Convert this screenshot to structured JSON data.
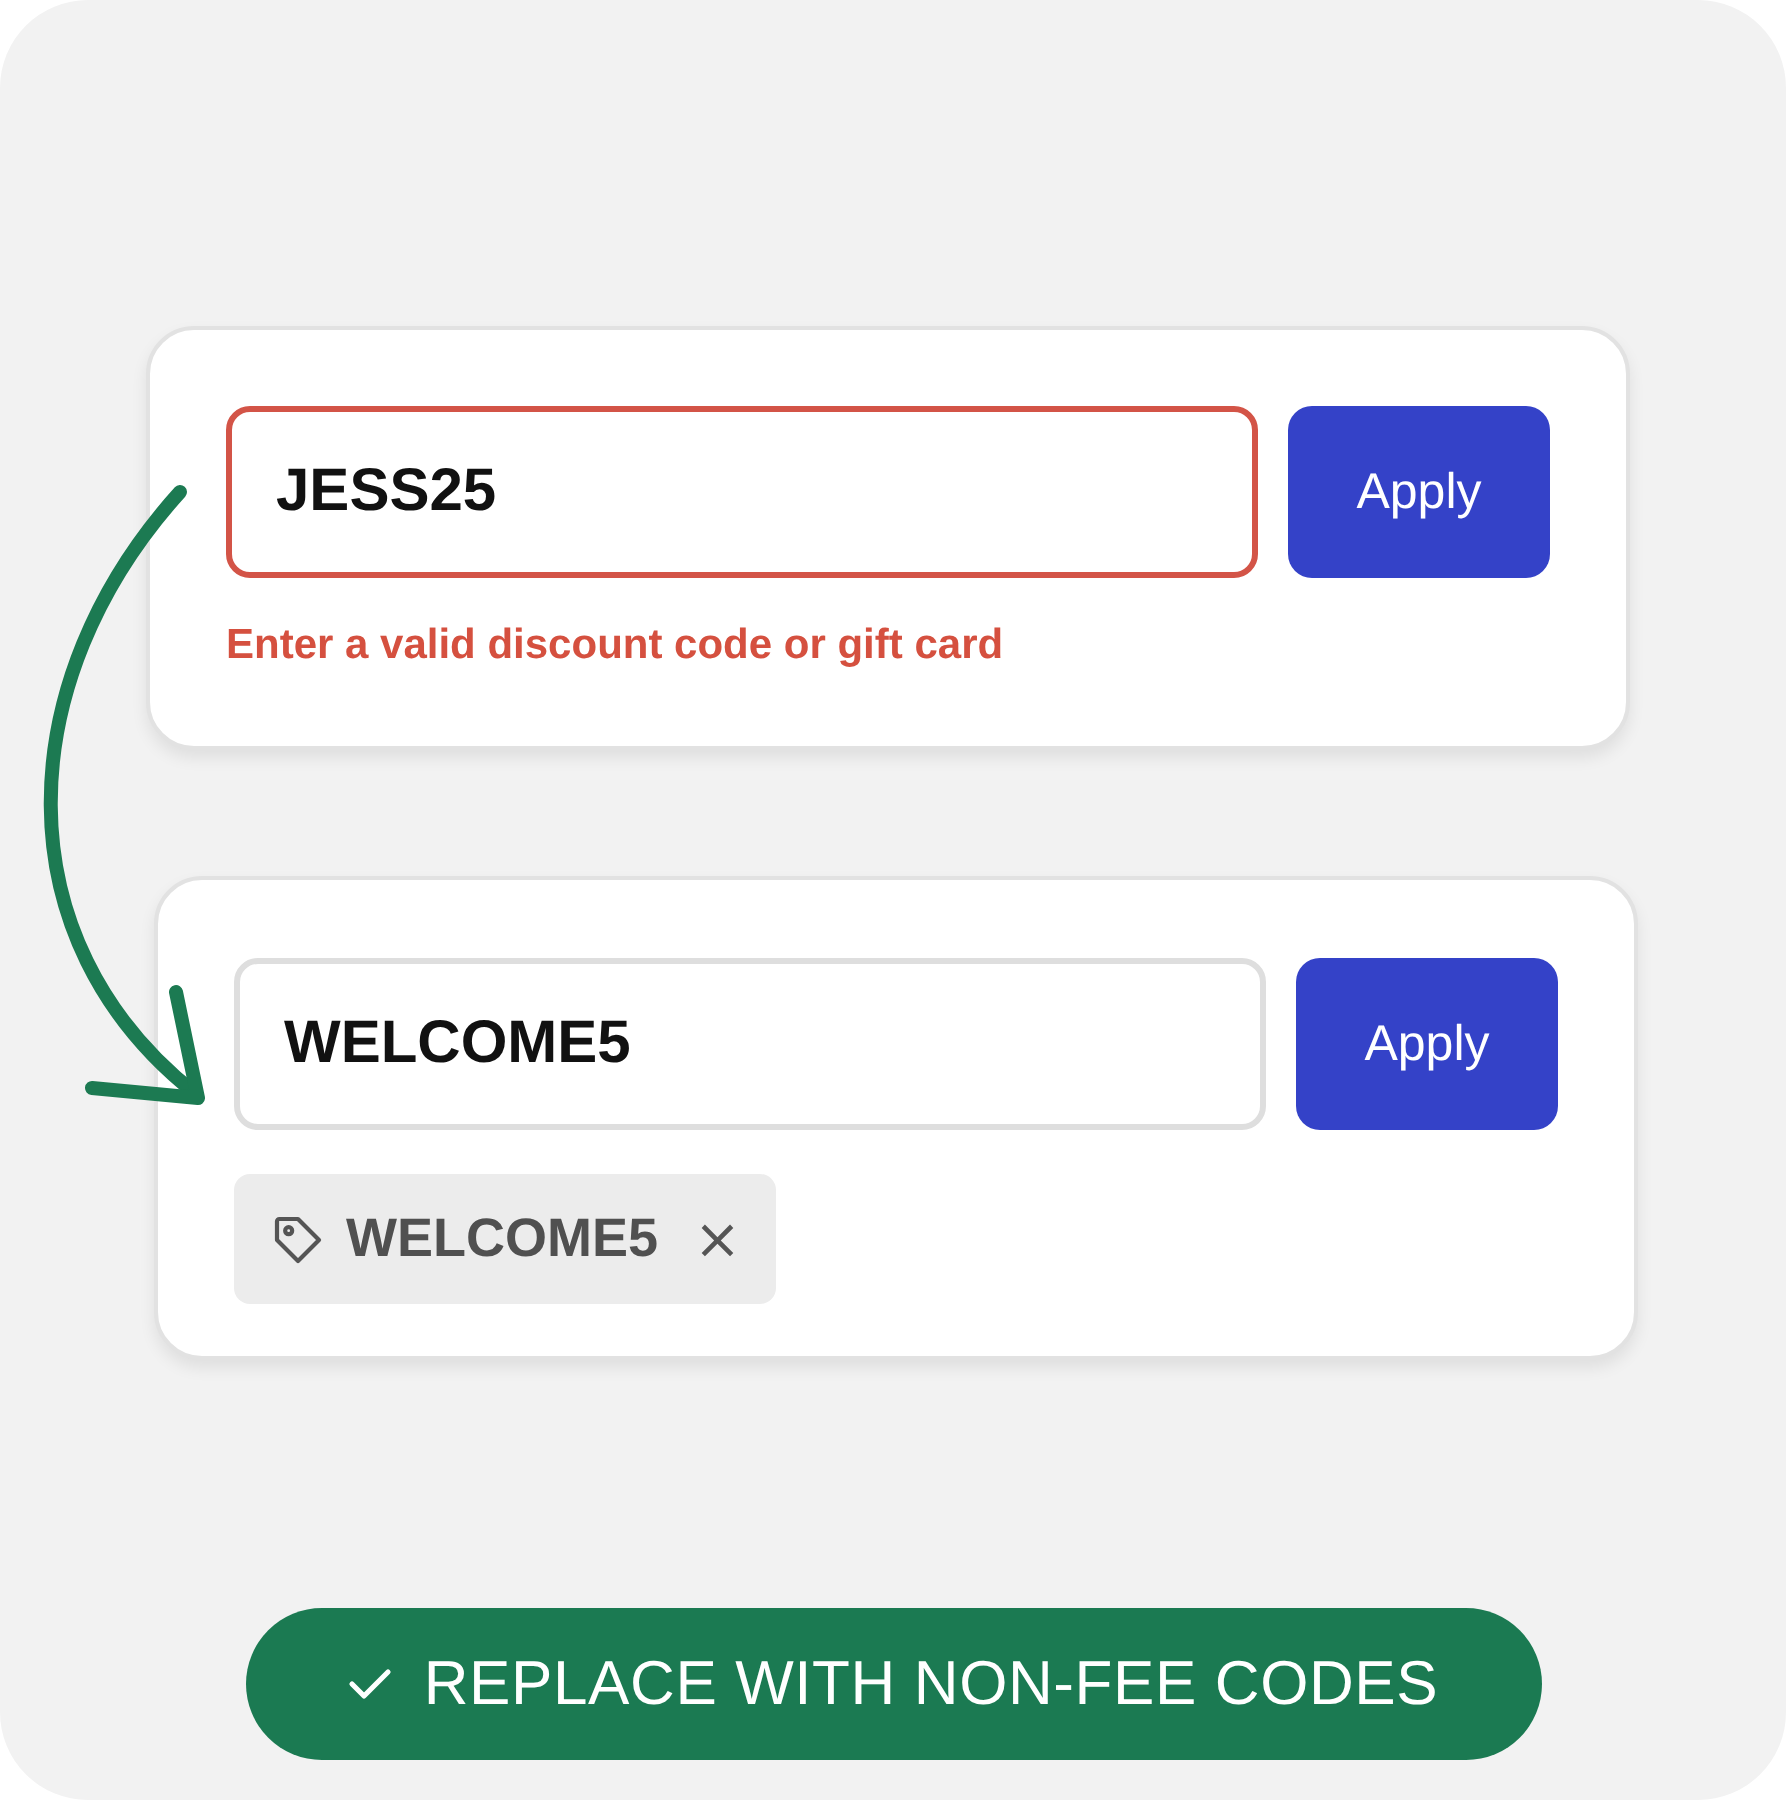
{
  "cards": [
    {
      "code": {
        "value": "JESS25",
        "invalid": true
      },
      "button": "Apply",
      "error": "Enter a valid discount code or gift card"
    },
    {
      "code": {
        "value": "WELCOME5",
        "invalid": false
      },
      "button": "Apply",
      "applied_tag": {
        "label": "WELCOME5",
        "remove": "×"
      }
    }
  ],
  "banner": {
    "label": "REPLACE WITH NON-FEE CODES"
  }
}
